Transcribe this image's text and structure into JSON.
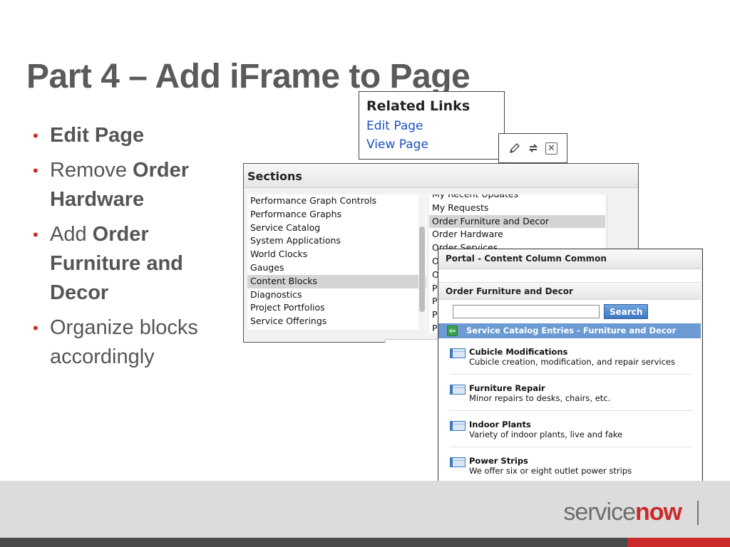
{
  "slide": {
    "title": "Part 4 – Add iFrame to Page",
    "bullets": [
      {
        "parts": [
          {
            "text": "Edit Page",
            "bold": true
          }
        ]
      },
      {
        "parts": [
          {
            "text": "Remove ",
            "bold": false
          },
          {
            "text": "Order Hardware",
            "bold": true
          }
        ]
      },
      {
        "parts": [
          {
            "text": "Add ",
            "bold": false
          },
          {
            "text": "Order Furniture and Decor",
            "bold": true
          }
        ]
      },
      {
        "parts": [
          {
            "text": "Organize blocks accordingly",
            "bold": false
          }
        ]
      }
    ]
  },
  "related_links": {
    "title": "Related Links",
    "links": [
      "Edit Page",
      "View Page"
    ]
  },
  "toolbar": {
    "icons": [
      "pencil-icon",
      "refresh-icon",
      "close-icon"
    ]
  },
  "sections": {
    "title": "Sections",
    "left_items": [
      "Performance Graph Controls",
      "Performance Graphs",
      "Service Catalog",
      "System Applications",
      "World Clocks",
      "Gauges",
      "Content Blocks",
      "Diagnostics",
      "Project Portfolios",
      "Service Offerings"
    ],
    "left_selected": "Content Blocks",
    "right_items": [
      "My Recent Updates",
      "My Requests",
      "Order Furniture and Decor",
      "Order Hardware",
      "Order Services",
      "O",
      "O",
      "P",
      "P",
      "P",
      "P"
    ],
    "right_selected": "Order Furniture and Decor"
  },
  "portal": {
    "title": "Portal - Content Column Common",
    "subtitle": "Order Furniture and Decor",
    "search": {
      "value": "",
      "button": "Search"
    },
    "category": "Service Catalog Entries - Furniture and Decor",
    "items": [
      {
        "title": "Cubicle Modifications",
        "desc": "Cubicle creation, modification, and repair services"
      },
      {
        "title": "Furniture Repair",
        "desc": "Minor repairs to desks, chairs, etc."
      },
      {
        "title": "Indoor Plants",
        "desc": "Variety of indoor plants, live and fake"
      },
      {
        "title": "Power Strips",
        "desc": "We offer six or eight outlet power strips"
      }
    ]
  },
  "footer": {
    "logo_service": "service",
    "logo_now": "now",
    "colors": {
      "brand_red": "#cc2929",
      "footer_gray": "#dcdcdc",
      "bar_dark": "#4a4a4a"
    }
  }
}
